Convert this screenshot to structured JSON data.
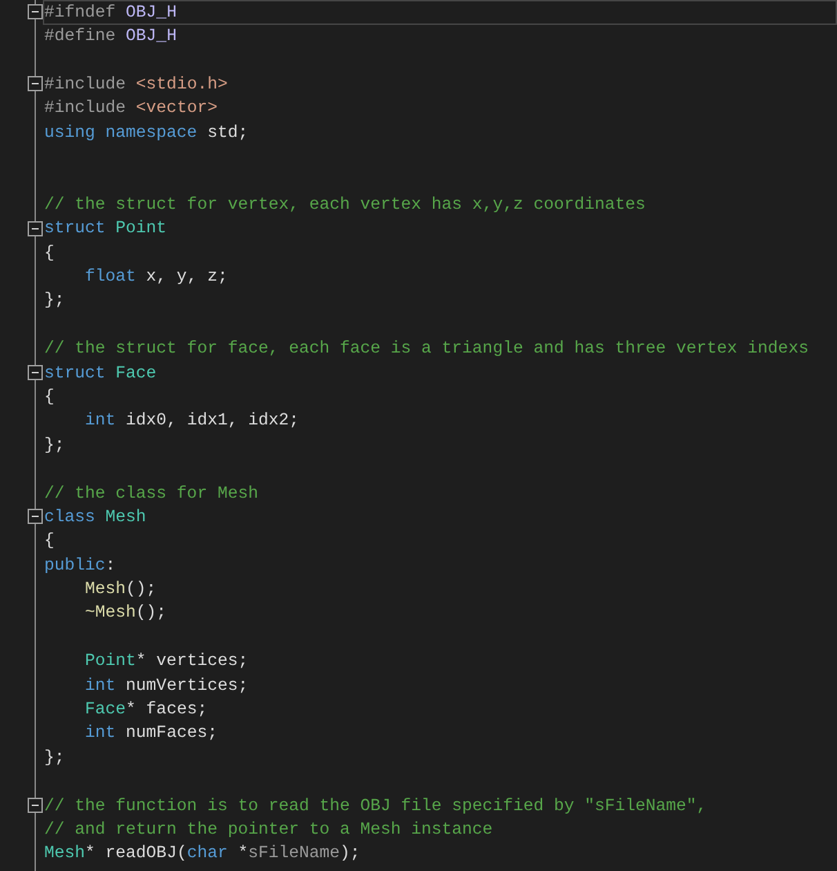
{
  "editor": {
    "lines": [
      {
        "fold_start": true,
        "current": true,
        "tokens": [
          {
            "text": "#ifndef ",
            "kind": "preproc"
          },
          {
            "text": "OBJ_H",
            "kind": "macro"
          }
        ]
      },
      {
        "fold_start": false,
        "current": false,
        "tokens": [
          {
            "text": "#define ",
            "kind": "preproc"
          },
          {
            "text": "OBJ_H",
            "kind": "macro"
          }
        ]
      },
      {
        "fold_start": false,
        "current": false
      },
      {
        "fold_start": true,
        "current": false,
        "tokens": [
          {
            "text": "#include ",
            "kind": "preproc"
          },
          {
            "text": "<stdio.h>",
            "kind": "string"
          }
        ]
      },
      {
        "fold_start": false,
        "current": false,
        "tokens": [
          {
            "text": "#include ",
            "kind": "preproc"
          },
          {
            "text": "<vector>",
            "kind": "string"
          }
        ]
      },
      {
        "fold_start": false,
        "current": false,
        "tokens": [
          {
            "text": "using namespace ",
            "kind": "keyword"
          },
          {
            "text": "std;",
            "kind": "plain"
          }
        ]
      },
      {
        "fold_start": false,
        "current": false
      },
      {
        "fold_start": false,
        "current": false
      },
      {
        "fold_start": false,
        "current": false,
        "tokens": [
          {
            "text": "// the struct for vertex, each vertex has x,y,z coordinates",
            "kind": "comment"
          }
        ]
      },
      {
        "fold_start": true,
        "current": false,
        "tokens": [
          {
            "text": "struct ",
            "kind": "keyword"
          },
          {
            "text": "Point",
            "kind": "type"
          }
        ]
      },
      {
        "fold_start": false,
        "current": false,
        "tokens": [
          {
            "text": "{",
            "kind": "plain"
          }
        ]
      },
      {
        "fold_start": false,
        "current": false,
        "tokens": [
          {
            "text": "    float ",
            "kind": "keyword"
          },
          {
            "text": "x, y, z;",
            "kind": "plain"
          }
        ]
      },
      {
        "fold_start": false,
        "current": false,
        "tokens": [
          {
            "text": "};",
            "kind": "plain"
          }
        ]
      },
      {
        "fold_start": false,
        "current": false
      },
      {
        "fold_start": false,
        "current": false,
        "tokens": [
          {
            "text": "// the struct for face, each face is a triangle and has three vertex indexs",
            "kind": "comment"
          }
        ]
      },
      {
        "fold_start": true,
        "current": false,
        "tokens": [
          {
            "text": "struct ",
            "kind": "keyword"
          },
          {
            "text": "Face",
            "kind": "type"
          }
        ]
      },
      {
        "fold_start": false,
        "current": false,
        "tokens": [
          {
            "text": "{",
            "kind": "plain"
          }
        ]
      },
      {
        "fold_start": false,
        "current": false,
        "tokens": [
          {
            "text": "    int ",
            "kind": "keyword"
          },
          {
            "text": "idx0, idx1, idx2;",
            "kind": "plain"
          }
        ]
      },
      {
        "fold_start": false,
        "current": false,
        "tokens": [
          {
            "text": "};",
            "kind": "plain"
          }
        ]
      },
      {
        "fold_start": false,
        "current": false
      },
      {
        "fold_start": false,
        "current": false,
        "tokens": [
          {
            "text": "// the class for Mesh",
            "kind": "comment"
          }
        ]
      },
      {
        "fold_start": true,
        "current": false,
        "tokens": [
          {
            "text": "class ",
            "kind": "keyword"
          },
          {
            "text": "Mesh",
            "kind": "type"
          }
        ]
      },
      {
        "fold_start": false,
        "current": false,
        "tokens": [
          {
            "text": "{",
            "kind": "plain"
          }
        ]
      },
      {
        "fold_start": false,
        "current": false,
        "tokens": [
          {
            "text": "public",
            "kind": "keyword"
          },
          {
            "text": ":",
            "kind": "plain"
          }
        ]
      },
      {
        "fold_start": false,
        "current": false,
        "tokens": [
          {
            "text": "    Mesh",
            "kind": "function"
          },
          {
            "text": "();",
            "kind": "plain"
          }
        ]
      },
      {
        "fold_start": false,
        "current": false,
        "tokens": [
          {
            "text": "    ~Mesh",
            "kind": "function"
          },
          {
            "text": "();",
            "kind": "plain"
          }
        ]
      },
      {
        "fold_start": false,
        "current": false
      },
      {
        "fold_start": false,
        "current": false,
        "tokens": [
          {
            "text": "    Point",
            "kind": "type"
          },
          {
            "text": "* vertices;",
            "kind": "plain"
          }
        ]
      },
      {
        "fold_start": false,
        "current": false,
        "tokens": [
          {
            "text": "    int ",
            "kind": "keyword"
          },
          {
            "text": "numVertices;",
            "kind": "plain"
          }
        ]
      },
      {
        "fold_start": false,
        "current": false,
        "tokens": [
          {
            "text": "    Face",
            "kind": "type"
          },
          {
            "text": "* faces;",
            "kind": "plain"
          }
        ]
      },
      {
        "fold_start": false,
        "current": false,
        "tokens": [
          {
            "text": "    int ",
            "kind": "keyword"
          },
          {
            "text": "numFaces;",
            "kind": "plain"
          }
        ]
      },
      {
        "fold_start": false,
        "current": false,
        "tokens": [
          {
            "text": "};",
            "kind": "plain"
          }
        ]
      },
      {
        "fold_start": false,
        "current": false
      },
      {
        "fold_start": true,
        "current": false,
        "tokens": [
          {
            "text": "// the function is to read the OBJ file specified by \"sFileName\",",
            "kind": "comment"
          }
        ]
      },
      {
        "fold_start": false,
        "current": false,
        "tokens": [
          {
            "text": "// and return the pointer to a Mesh instance",
            "kind": "comment"
          }
        ]
      },
      {
        "fold_start": false,
        "current": false,
        "tokens": [
          {
            "text": "Mesh",
            "kind": "type"
          },
          {
            "text": "* readOBJ(",
            "kind": "plain"
          },
          {
            "text": "char ",
            "kind": "keyword"
          },
          {
            "text": "*",
            "kind": "plain"
          },
          {
            "text": "sFileName",
            "kind": "param"
          },
          {
            "text": ");",
            "kind": "plain"
          }
        ]
      }
    ]
  }
}
